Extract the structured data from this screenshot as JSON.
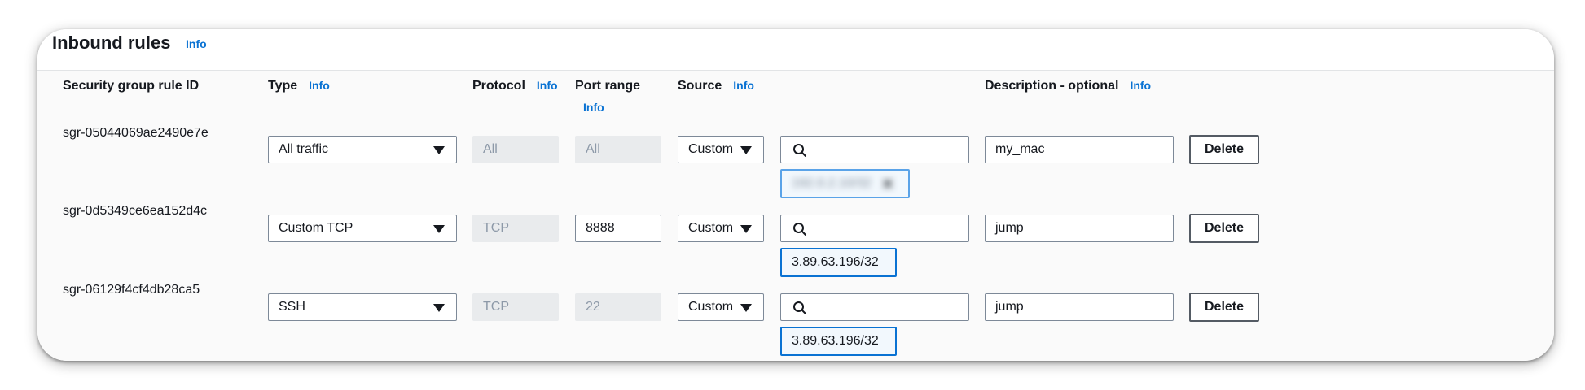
{
  "section": {
    "title": "Inbound rules",
    "title_info": "Info"
  },
  "columns": {
    "rule_id": "Security group rule ID",
    "type": "Type",
    "type_info": "Info",
    "protocol": "Protocol",
    "protocol_info": "Info",
    "port_range": "Port range",
    "port_range_info": "Info",
    "source": "Source",
    "source_info": "Info",
    "description": "Description - optional",
    "description_info": "Info"
  },
  "rules": [
    {
      "id": "sgr-05044069ae2490e7e",
      "type": "All traffic",
      "protocol": "All",
      "port_range": "All",
      "source": "Custom",
      "token": "192.0.2.10/32",
      "token_blurred": true,
      "description": "my_mac",
      "delete_label": "Delete"
    },
    {
      "id": "sgr-0d5349ce6ea152d4c",
      "type": "Custom TCP",
      "protocol": "TCP",
      "port_range": "8888",
      "source": "Custom",
      "token": "3.89.63.196/32",
      "token_blurred": false,
      "description": "jump",
      "delete_label": "Delete"
    },
    {
      "id": "sgr-06129f4cf4db28ca5",
      "type": "SSH",
      "protocol": "TCP",
      "port_range": "22",
      "source": "Custom",
      "token": "3.89.63.196/32",
      "token_blurred": false,
      "description": "jump",
      "delete_label": "Delete"
    }
  ],
  "icons": {
    "search": "search-icon",
    "dropdown": "caret-down-icon",
    "remove": "close-icon"
  },
  "colors": {
    "link": "#0972d3",
    "token_border": "#0972d3",
    "disabled_bg": "#e9ebed"
  }
}
